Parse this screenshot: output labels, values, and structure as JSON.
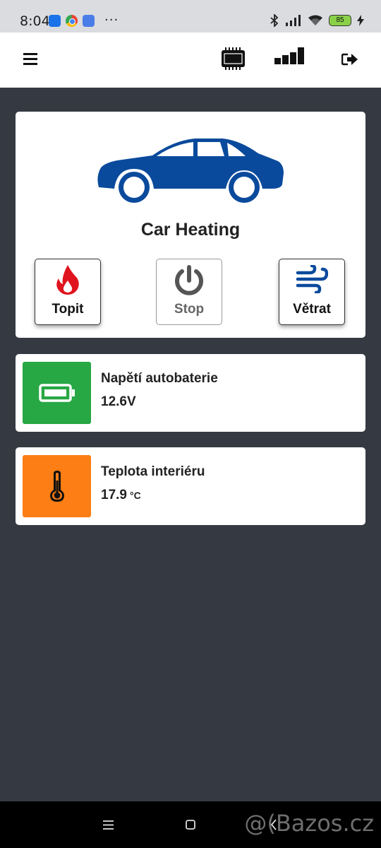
{
  "status_bar": {
    "time": "8:04",
    "more": "···",
    "battery_level": "85",
    "icons": [
      "chat-notification-icon",
      "chrome-icon",
      "app-notification-icon",
      "bluetooth-icon",
      "signal-icon",
      "wifi-icon",
      "battery-icon",
      "charging-icon"
    ]
  },
  "header": {
    "icons": [
      "menu-icon",
      "chip-icon",
      "signal-strength-icon",
      "logout-icon"
    ]
  },
  "hero": {
    "title": "Car Heating",
    "car_color": "#0a4a9c",
    "actions": [
      {
        "label": "Topit",
        "icon": "fire-icon",
        "color": "#e0141e",
        "state": "active"
      },
      {
        "label": "Stop",
        "icon": "power-icon",
        "color": "#555555",
        "state": "inactive"
      },
      {
        "label": "Větrat",
        "icon": "wind-icon",
        "color": "#0a4a9c",
        "state": "active"
      }
    ]
  },
  "sensors": [
    {
      "title": "Napětí autobaterie",
      "value": "12.6V",
      "unit": "",
      "icon": "battery-icon",
      "tile_color": "#28a745"
    },
    {
      "title": "Teplota interiéru",
      "value": "17.9",
      "unit": "°C",
      "icon": "thermometer-icon",
      "tile_color": "#fd7e14"
    }
  ],
  "nav_bar": {
    "icons": [
      "recents-icon",
      "home-icon",
      "back-icon"
    ],
    "watermark": "@(Bazos.cz"
  }
}
